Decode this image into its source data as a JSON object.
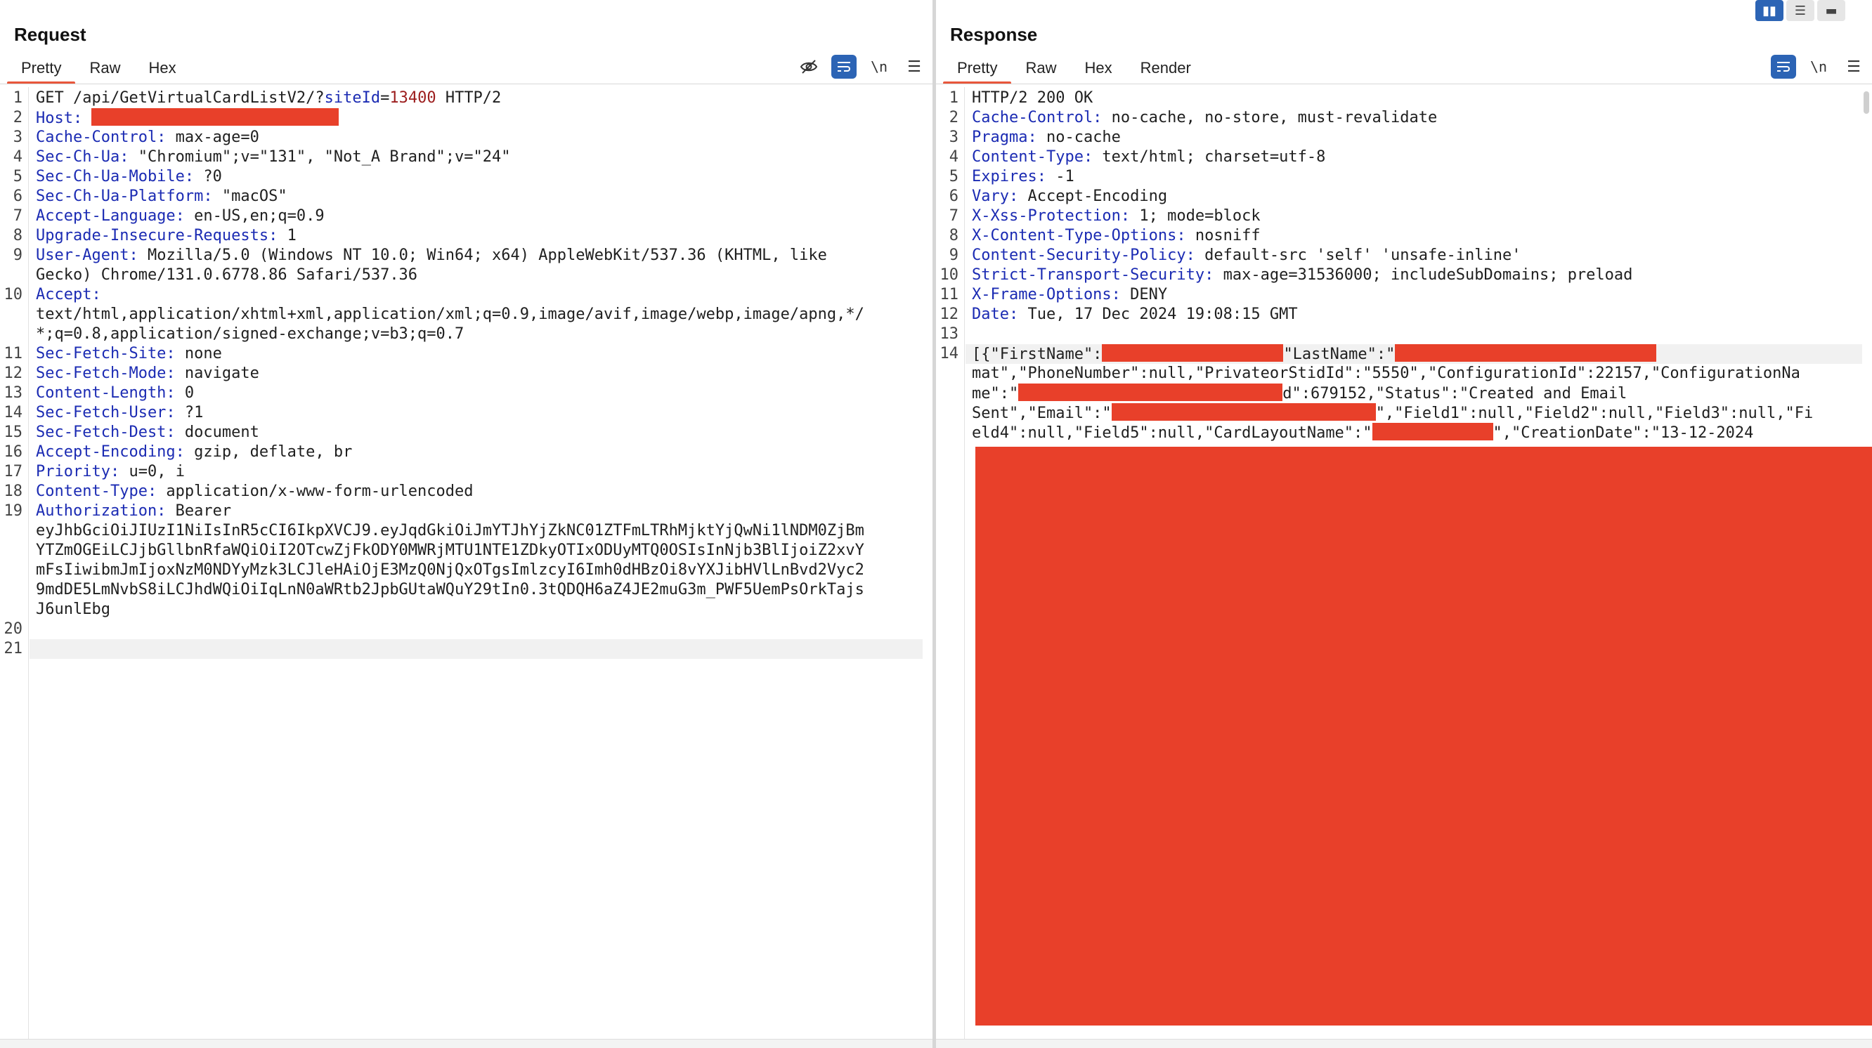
{
  "request": {
    "title": "Request",
    "tabs": [
      {
        "label": "Pretty",
        "active": true
      },
      {
        "label": "Raw",
        "active": false
      },
      {
        "label": "Hex",
        "active": false
      }
    ],
    "tools": {
      "hide_icon": "eye-slash-icon",
      "wrap_icon": "wrap-lines-icon",
      "newline_label": "\\n",
      "menu_icon": "hamburger-icon"
    },
    "lines": [
      {
        "n": "1",
        "parts": [
          {
            "t": "GET /api/GetVirtualCardListV2/?"
          },
          {
            "t": "siteId",
            "c": "kw"
          },
          {
            "t": "="
          },
          {
            "t": "13400",
            "c": "num"
          },
          {
            "t": " HTTP/2"
          }
        ]
      },
      {
        "n": "2",
        "parts": [
          {
            "t": "Host:",
            "c": "hdr"
          },
          {
            "t": " "
          },
          {
            "redact": 352
          }
        ]
      },
      {
        "n": "3",
        "parts": [
          {
            "t": "Cache-Control:",
            "c": "hdr"
          },
          {
            "t": " max-age=0"
          }
        ]
      },
      {
        "n": "4",
        "parts": [
          {
            "t": "Sec-Ch-Ua:",
            "c": "hdr"
          },
          {
            "t": " \"Chromium\";v=\"131\", \"Not_A Brand\";v=\"24\""
          }
        ]
      },
      {
        "n": "5",
        "parts": [
          {
            "t": "Sec-Ch-Ua-Mobile:",
            "c": "hdr"
          },
          {
            "t": " ?0"
          }
        ]
      },
      {
        "n": "6",
        "parts": [
          {
            "t": "Sec-Ch-Ua-Platform:",
            "c": "hdr"
          },
          {
            "t": " \"macOS\""
          }
        ]
      },
      {
        "n": "7",
        "parts": [
          {
            "t": "Accept-Language:",
            "c": "hdr"
          },
          {
            "t": " en-US,en;q=0.9"
          }
        ]
      },
      {
        "n": "8",
        "parts": [
          {
            "t": "Upgrade-Insecure-Requests:",
            "c": "hdr"
          },
          {
            "t": " 1"
          }
        ]
      },
      {
        "n": "9",
        "parts": [
          {
            "t": "User-Agent:",
            "c": "hdr"
          },
          {
            "t": " Mozilla/5.0 (Windows NT 10.0; Win64; x64) AppleWebKit/537.36 (KHTML, like"
          }
        ]
      },
      {
        "n": "",
        "parts": [
          {
            "t": "Gecko) Chrome/131.0.6778.86 Safari/537.36"
          }
        ]
      },
      {
        "n": "10",
        "parts": [
          {
            "t": "Accept:",
            "c": "hdr"
          }
        ]
      },
      {
        "n": "",
        "parts": [
          {
            "t": "text/html,application/xhtml+xml,application/xml;q=0.9,image/avif,image/webp,image/apng,*/"
          }
        ]
      },
      {
        "n": "",
        "parts": [
          {
            "t": "*;q=0.8,application/signed-exchange;v=b3;q=0.7"
          }
        ]
      },
      {
        "n": "11",
        "parts": [
          {
            "t": "Sec-Fetch-Site:",
            "c": "hdr"
          },
          {
            "t": " none"
          }
        ]
      },
      {
        "n": "12",
        "parts": [
          {
            "t": "Sec-Fetch-Mode:",
            "c": "hdr"
          },
          {
            "t": " navigate"
          }
        ]
      },
      {
        "n": "13",
        "parts": [
          {
            "t": "Content-Length:",
            "c": "hdr"
          },
          {
            "t": " 0"
          }
        ]
      },
      {
        "n": "14",
        "parts": [
          {
            "t": "Sec-Fetch-User:",
            "c": "hdr"
          },
          {
            "t": " ?1"
          }
        ]
      },
      {
        "n": "15",
        "parts": [
          {
            "t": "Sec-Fetch-Dest:",
            "c": "hdr"
          },
          {
            "t": " document"
          }
        ]
      },
      {
        "n": "16",
        "parts": [
          {
            "t": "Accept-Encoding:",
            "c": "hdr"
          },
          {
            "t": " gzip, deflate, br"
          }
        ]
      },
      {
        "n": "17",
        "parts": [
          {
            "t": "Priority:",
            "c": "hdr"
          },
          {
            "t": " u=0, i"
          }
        ]
      },
      {
        "n": "18",
        "parts": [
          {
            "t": "Content-Type:",
            "c": "hdr"
          },
          {
            "t": " application/x-www-form-urlencoded"
          }
        ]
      },
      {
        "n": "19",
        "parts": [
          {
            "t": "Authorization:",
            "c": "hdr"
          },
          {
            "t": " Bearer"
          }
        ]
      },
      {
        "n": "",
        "parts": [
          {
            "t": "eyJhbGciOiJIUzI1NiIsInR5cCI6IkpXVCJ9.eyJqdGkiOiJmYTJhYjZkNC01ZTFmLTRhMjktYjQwNi1lNDM0ZjBm"
          }
        ]
      },
      {
        "n": "",
        "parts": [
          {
            "t": "YTZmOGEiLCJjbGllbnRfaWQiOiI2OTcwZjFkODY0MWRjMTU1NTE1ZDkyOTIxODUyMTQ0OSIsInNjb3BlIjoiZ2xvY"
          }
        ]
      },
      {
        "n": "",
        "parts": [
          {
            "t": "mFsIiwibmJmIjoxNzM0NDYyMzk3LCJleHAiOjE3MzQ0NjQxOTgsImlzcyI6Imh0dHBzOi8vYXJibHVlLnBvd2Vyc2"
          }
        ]
      },
      {
        "n": "",
        "parts": [
          {
            "t": "9mdDE5LmNvbS8iLCJhdWQiOiIqLnN0aWRtb2JpbGUtaWQuY29tIn0.3tQDQH6aZ4JE2muG3m_PWF5UemPsOrkTajs"
          }
        ]
      },
      {
        "n": "",
        "parts": [
          {
            "t": "J6unlEbg"
          }
        ]
      },
      {
        "n": "20",
        "parts": []
      },
      {
        "n": "21",
        "parts": [],
        "highlight": true
      }
    ]
  },
  "response": {
    "title": "Response",
    "tabs": [
      {
        "label": "Pretty",
        "active": true
      },
      {
        "label": "Raw",
        "active": false
      },
      {
        "label": "Hex",
        "active": false
      },
      {
        "label": "Render",
        "active": false
      }
    ],
    "tools": {
      "wrap_icon": "wrap-lines-icon",
      "newline_label": "\\n",
      "menu_icon": "hamburger-icon"
    },
    "lines": [
      {
        "n": "1",
        "parts": [
          {
            "t": "HTTP/2 200 OK"
          }
        ]
      },
      {
        "n": "2",
        "parts": [
          {
            "t": "Cache-Control:",
            "c": "hdr"
          },
          {
            "t": " no-cache, no-store, must-revalidate"
          }
        ]
      },
      {
        "n": "3",
        "parts": [
          {
            "t": "Pragma:",
            "c": "hdr"
          },
          {
            "t": " no-cache"
          }
        ]
      },
      {
        "n": "4",
        "parts": [
          {
            "t": "Content-Type:",
            "c": "hdr"
          },
          {
            "t": " text/html; charset=utf-8"
          }
        ]
      },
      {
        "n": "5",
        "parts": [
          {
            "t": "Expires:",
            "c": "hdr"
          },
          {
            "t": " -1"
          }
        ]
      },
      {
        "n": "6",
        "parts": [
          {
            "t": "Vary:",
            "c": "hdr"
          },
          {
            "t": " Accept-Encoding"
          }
        ]
      },
      {
        "n": "7",
        "parts": [
          {
            "t": "X-Xss-Protection:",
            "c": "hdr"
          },
          {
            "t": " 1; mode=block"
          }
        ]
      },
      {
        "n": "8",
        "parts": [
          {
            "t": "X-Content-Type-Options:",
            "c": "hdr"
          },
          {
            "t": " nosniff"
          }
        ]
      },
      {
        "n": "9",
        "parts": [
          {
            "t": "Content-Security-Policy:",
            "c": "hdr"
          },
          {
            "t": " default-src 'self' 'unsafe-inline'"
          }
        ]
      },
      {
        "n": "10",
        "parts": [
          {
            "t": "Strict-Transport-Security:",
            "c": "hdr"
          },
          {
            "t": " max-age=31536000; includeSubDomains; preload"
          }
        ]
      },
      {
        "n": "11",
        "parts": [
          {
            "t": "X-Frame-Options:",
            "c": "hdr"
          },
          {
            "t": " DENY"
          }
        ]
      },
      {
        "n": "12",
        "parts": [
          {
            "t": "Date:",
            "c": "hdr"
          },
          {
            "t": " Tue, 17 Dec 2024 19:08:15 GMT"
          }
        ]
      },
      {
        "n": "13",
        "parts": []
      },
      {
        "n": "14",
        "highlight": true,
        "parts": [
          {
            "t": "[{\"FirstName\":"
          },
          {
            "redact": 258
          },
          {
            "t": "\"LastName\":\""
          },
          {
            "redact": 372
          }
        ]
      },
      {
        "n": "",
        "parts": [
          {
            "t": "mat\",\"PhoneNumber\":null,\"PrivateorStidId\":\"5550\",\"ConfigurationId\":22157,\"ConfigurationNa"
          }
        ]
      },
      {
        "n": "",
        "parts": [
          {
            "t": "me\":\""
          },
          {
            "redact": 376
          },
          {
            "t": "d\":679152,\"Status\":\"Created and Email"
          }
        ]
      },
      {
        "n": "",
        "parts": [
          {
            "t": "Sent\",\"Email\":\""
          },
          {
            "redact": 376
          },
          {
            "t": "\",\"Field1\":null,\"Field2\":null,\"Field3\":null,\"Fi"
          }
        ]
      },
      {
        "n": "",
        "parts": [
          {
            "t": "eld4\":null,\"Field5\":null,\"CardLayoutName\":\""
          },
          {
            "redact": 172
          },
          {
            "t": "\",\"CreationDate\":\"13-12-2024"
          }
        ]
      }
    ]
  }
}
